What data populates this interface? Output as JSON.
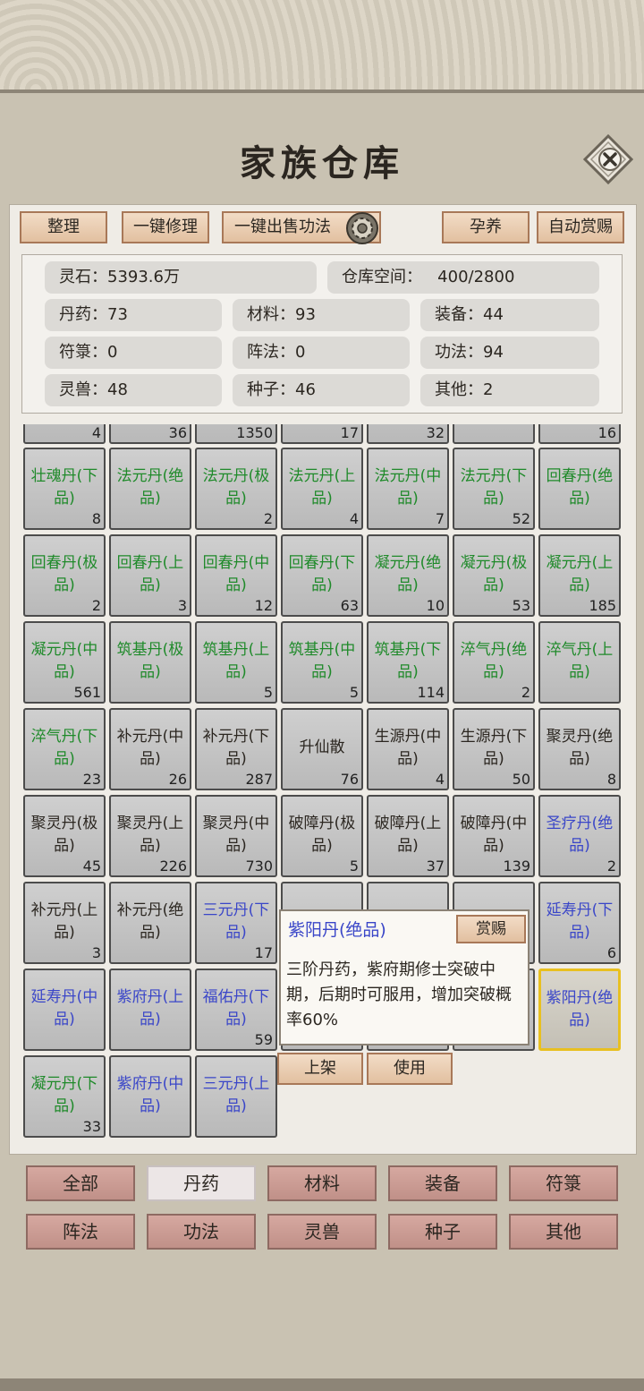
{
  "title": "家族仓库",
  "toolbar": {
    "sort": "整理",
    "repair_all": "一键修理",
    "sell_techniques": "一键出售功法",
    "nurture": "孕养",
    "auto_reward": "自动赏赐"
  },
  "stats": {
    "spirit_stone_label": "灵石：",
    "spirit_stone_value": "5393.6万",
    "storage_label": "仓库空间：",
    "storage_value": "400/2800",
    "pills": "丹药：73",
    "materials": "材料：93",
    "equipment": "装备：44",
    "talismans": "符箓：0",
    "formations": "阵法：0",
    "techniques": "功法：94",
    "beasts": "灵兽：48",
    "seeds": "种子：46",
    "others": "其他：2"
  },
  "partial_row": [
    "4",
    "36",
    "1350",
    "17",
    "32",
    "",
    "16"
  ],
  "items": [
    {
      "name": "壮魂丹(下品)",
      "count": "8",
      "color": "green"
    },
    {
      "name": "法元丹(绝品)",
      "count": "",
      "color": "green"
    },
    {
      "name": "法元丹(极品)",
      "count": "2",
      "color": "green"
    },
    {
      "name": "法元丹(上品)",
      "count": "4",
      "color": "green"
    },
    {
      "name": "法元丹(中品)",
      "count": "7",
      "color": "green"
    },
    {
      "name": "法元丹(下品)",
      "count": "52",
      "color": "green"
    },
    {
      "name": "回春丹(绝品)",
      "count": "",
      "color": "green"
    },
    {
      "name": "回春丹(极品)",
      "count": "2",
      "color": "green"
    },
    {
      "name": "回春丹(上品)",
      "count": "3",
      "color": "green"
    },
    {
      "name": "回春丹(中品)",
      "count": "12",
      "color": "green"
    },
    {
      "name": "回春丹(下品)",
      "count": "63",
      "color": "green"
    },
    {
      "name": "凝元丹(绝品)",
      "count": "10",
      "color": "green"
    },
    {
      "name": "凝元丹(极品)",
      "count": "53",
      "color": "green"
    },
    {
      "name": "凝元丹(上品)",
      "count": "185",
      "color": "green"
    },
    {
      "name": "凝元丹(中品)",
      "count": "561",
      "color": "green"
    },
    {
      "name": "筑基丹(极品)",
      "count": "",
      "color": "green"
    },
    {
      "name": "筑基丹(上品)",
      "count": "5",
      "color": "green"
    },
    {
      "name": "筑基丹(中品)",
      "count": "5",
      "color": "green"
    },
    {
      "name": "筑基丹(下品)",
      "count": "114",
      "color": "green"
    },
    {
      "name": "淬气丹(绝品)",
      "count": "2",
      "color": "green"
    },
    {
      "name": "淬气丹(上品)",
      "count": "",
      "color": "green"
    },
    {
      "name": "淬气丹(下品)",
      "count": "23",
      "color": "green"
    },
    {
      "name": "补元丹(中品)",
      "count": "26",
      "color": "black"
    },
    {
      "name": "补元丹(下品)",
      "count": "287",
      "color": "black"
    },
    {
      "name": "升仙散",
      "count": "76",
      "color": "black"
    },
    {
      "name": "生源丹(中品)",
      "count": "4",
      "color": "black"
    },
    {
      "name": "生源丹(下品)",
      "count": "50",
      "color": "black"
    },
    {
      "name": "聚灵丹(绝品)",
      "count": "8",
      "color": "black"
    },
    {
      "name": "聚灵丹(极品)",
      "count": "45",
      "color": "black"
    },
    {
      "name": "聚灵丹(上品)",
      "count": "226",
      "color": "black"
    },
    {
      "name": "聚灵丹(中品)",
      "count": "730",
      "color": "black"
    },
    {
      "name": "破障丹(极品)",
      "count": "5",
      "color": "black"
    },
    {
      "name": "破障丹(上品)",
      "count": "37",
      "color": "black"
    },
    {
      "name": "破障丹(中品)",
      "count": "139",
      "color": "black"
    },
    {
      "name": "圣疗丹(绝品)",
      "count": "2",
      "color": "blue"
    },
    {
      "name": "补元丹(上品)",
      "count": "3",
      "color": "black"
    },
    {
      "name": "补元丹(绝品)",
      "count": "",
      "color": "black"
    },
    {
      "name": "三元丹(下品)",
      "count": "17",
      "color": "blue"
    },
    {
      "name": "",
      "count": "",
      "color": "blue"
    },
    {
      "name": "",
      "count": "",
      "color": "blue"
    },
    {
      "name": "",
      "count": "",
      "color": "blue"
    },
    {
      "name": "延寿丹(下品)",
      "count": "6",
      "color": "blue"
    },
    {
      "name": "延寿丹(中品)",
      "count": "",
      "color": "blue"
    },
    {
      "name": "紫府丹(上品)",
      "count": "",
      "color": "blue"
    },
    {
      "name": "福佑丹(下品)",
      "count": "59",
      "color": "blue"
    },
    {
      "name": "",
      "count": "",
      "color": "blue"
    },
    {
      "name": "",
      "count": "",
      "color": "blue"
    },
    {
      "name": "",
      "count": "",
      "color": "blue"
    },
    {
      "name": "紫阳丹(绝品)",
      "count": "",
      "color": "blue",
      "selected": true
    },
    {
      "name": "凝元丹(下品)",
      "count": "33",
      "color": "green"
    },
    {
      "name": "紫府丹(中品)",
      "count": "",
      "color": "blue"
    },
    {
      "name": "三元丹(上品)",
      "count": "",
      "color": "blue"
    }
  ],
  "popup": {
    "name": "紫阳丹(绝品)",
    "reward": "赏赐",
    "description": "三阶丹药，紫府期修士突破中期，后期时可服用，增加突破概率60%",
    "list_button": "上架",
    "use_button": "使用"
  },
  "tabs": [
    {
      "label": "全部",
      "active": false
    },
    {
      "label": "丹药",
      "active": true
    },
    {
      "label": "材料",
      "active": false
    },
    {
      "label": "装备",
      "active": false
    },
    {
      "label": "符箓",
      "active": false
    },
    {
      "label": "阵法",
      "active": false
    },
    {
      "label": "功法",
      "active": false
    },
    {
      "label": "灵兽",
      "active": false
    },
    {
      "label": "种子",
      "active": false
    },
    {
      "label": "其他",
      "active": false
    }
  ],
  "colors": {
    "green": "#1f8a2a",
    "blue": "#3a46c8",
    "black": "#2b2620",
    "selected_border": "#e8c020"
  }
}
